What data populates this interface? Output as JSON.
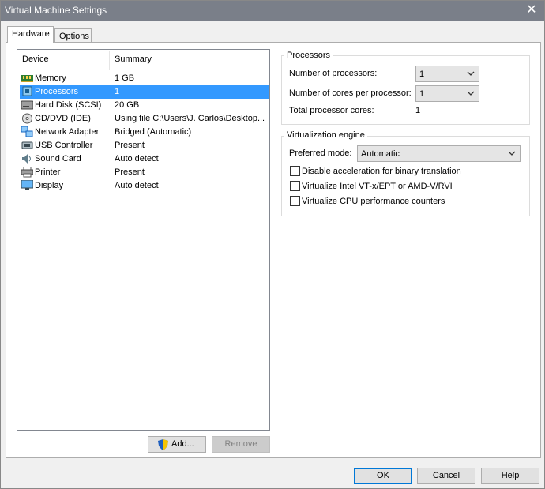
{
  "window": {
    "title": "Virtual Machine Settings"
  },
  "tabs": [
    {
      "label": "Hardware",
      "active": true
    },
    {
      "label": "Options",
      "active": false
    }
  ],
  "device_list": {
    "columns": [
      "Device",
      "Summary"
    ],
    "rows": [
      {
        "device": "Memory",
        "summary": "1 GB",
        "icon": "memory-icon"
      },
      {
        "device": "Processors",
        "summary": "1",
        "icon": "processor-icon",
        "selected": true
      },
      {
        "device": "Hard Disk (SCSI)",
        "summary": "20 GB",
        "icon": "hard-disk-icon"
      },
      {
        "device": "CD/DVD (IDE)",
        "summary": "Using file C:\\Users\\J. Carlos\\Desktop...",
        "icon": "cd-dvd-icon"
      },
      {
        "device": "Network Adapter",
        "summary": "Bridged (Automatic)",
        "icon": "network-adapter-icon"
      },
      {
        "device": "USB Controller",
        "summary": "Present",
        "icon": "usb-icon"
      },
      {
        "device": "Sound Card",
        "summary": "Auto detect",
        "icon": "sound-card-icon"
      },
      {
        "device": "Printer",
        "summary": "Present",
        "icon": "printer-icon"
      },
      {
        "device": "Display",
        "summary": "Auto detect",
        "icon": "display-icon"
      }
    ]
  },
  "list_buttons": {
    "add_label": "Add...",
    "remove_label": "Remove"
  },
  "processors_group": {
    "title": "Processors",
    "num_processors_label": "Number of processors:",
    "num_processors_value": "1",
    "cores_label": "Number of cores per processor:",
    "cores_value": "1",
    "total_label": "Total processor cores:",
    "total_value": "1"
  },
  "virtualization_group": {
    "title": "Virtualization engine",
    "mode_label": "Preferred mode:",
    "mode_value": "Automatic",
    "options": [
      {
        "label": "Disable acceleration for binary translation",
        "checked": false
      },
      {
        "label": "Virtualize Intel VT-x/EPT or AMD-V/RVI",
        "checked": false
      },
      {
        "label": "Virtualize CPU performance counters",
        "checked": false
      }
    ]
  },
  "footer": {
    "ok_label": "OK",
    "cancel_label": "Cancel",
    "help_label": "Help"
  },
  "colors": {
    "selection": "#3399ff",
    "titlebar": "#7a7f89",
    "focus_border": "#0078d7"
  }
}
